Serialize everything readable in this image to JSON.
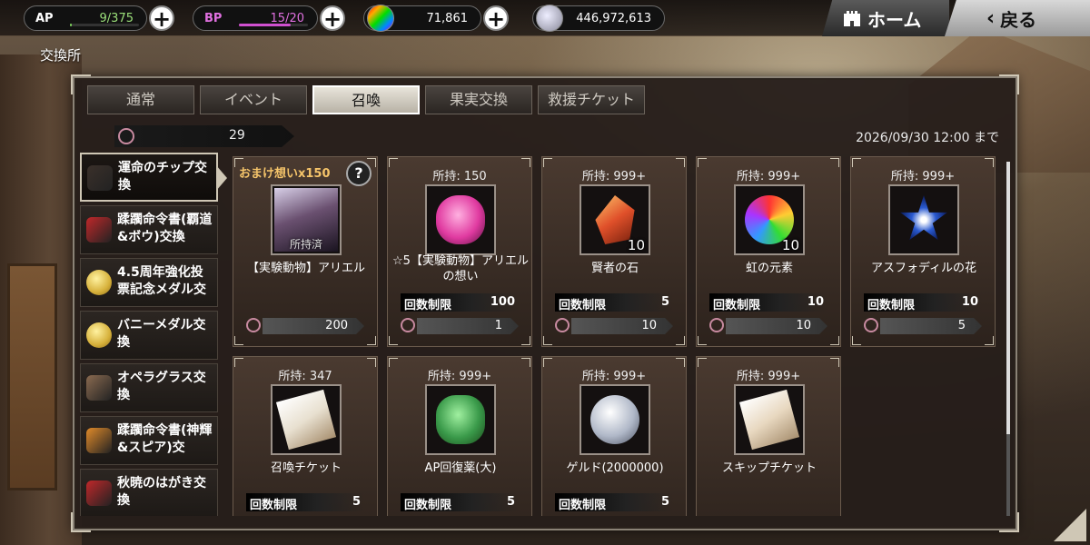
{
  "topbar": {
    "ap": {
      "label": "AP",
      "value": "9/375",
      "fill": 0.024
    },
    "bp": {
      "label": "BP",
      "value": "15/20",
      "fill": 0.75
    },
    "crystals": "71,861",
    "money": "446,972,613",
    "home_label": "ホーム",
    "back_label": "戻る"
  },
  "page_title": "交換所",
  "tabs": [
    "通常",
    "イベント",
    "召喚",
    "果実交換",
    "救援チケット"
  ],
  "active_tab": 2,
  "currency_count": "29",
  "deadline": "2026/09/30 12:00 まで",
  "sidebar": [
    {
      "label": "運命のチップ交換",
      "icon": "chip-icon",
      "color": "#3a302a"
    },
    {
      "label": "蹂躙命令書(覇道&ボウ)交換",
      "icon": "scroll-red-icon",
      "color": "#c0282a"
    },
    {
      "label": "4.5周年強化投票記念メダル交",
      "icon": "medal-icon",
      "color": "#d6b03a"
    },
    {
      "label": "バニーメダル交換",
      "icon": "medal-icon",
      "color": "#d6b03a"
    },
    {
      "label": "オペラグラス交換",
      "icon": "opera-glass-icon",
      "color": "#8a6a50"
    },
    {
      "label": "蹂躙命令書(神輝&スピア)交",
      "icon": "scroll-orange-icon",
      "color": "#e08a2a"
    },
    {
      "label": "秋暁のはがき交換",
      "icon": "postcard-icon",
      "color": "#c0282a"
    }
  ],
  "items": [
    {
      "bonus": "おまけ想いx150",
      "owned": "",
      "qty": "",
      "owned_tag": "所持済",
      "name": "【実験動物】アリエル",
      "limit_label": "",
      "limit": "",
      "cost": "200",
      "icon": "character-portrait-icon",
      "color": "#6a5070"
    },
    {
      "bonus": "",
      "owned": "所持: 150",
      "qty": "",
      "owned_tag": "",
      "name": "☆5【実験動物】アリエルの想い",
      "limit_label": "回数制限",
      "limit": "100",
      "cost": "1",
      "icon": "pink-gem-icon",
      "color": "#e03aa0"
    },
    {
      "bonus": "",
      "owned": "所持: 999+",
      "qty": "10",
      "owned_tag": "",
      "name": "賢者の石",
      "limit_label": "回数制限",
      "limit": "5",
      "cost": "10",
      "icon": "red-crystal-icon",
      "color": "#e0502a"
    },
    {
      "bonus": "",
      "owned": "所持: 999+",
      "qty": "10",
      "owned_tag": "",
      "name": "虹の元素",
      "limit_label": "回数制限",
      "limit": "10",
      "cost": "10",
      "icon": "rainbow-orb-icon",
      "color": "#8a4ad0"
    },
    {
      "bonus": "",
      "owned": "所持: 999+",
      "qty": "",
      "owned_tag": "",
      "name": "アスフォディルの花",
      "limit_label": "回数制限",
      "limit": "10",
      "cost": "5",
      "icon": "blue-flower-icon",
      "color": "#2a5ad0"
    },
    {
      "bonus": "",
      "owned": "所持: 347",
      "qty": "",
      "owned_tag": "",
      "name": "召喚チケット",
      "limit_label": "回数制限",
      "limit": "5",
      "cost": "",
      "icon": "ticket-icon",
      "color": "#e8e0d0"
    },
    {
      "bonus": "",
      "owned": "所持: 999+",
      "qty": "",
      "owned_tag": "",
      "name": "AP回復薬(大)",
      "limit_label": "回数制限",
      "limit": "5",
      "cost": "",
      "icon": "potion-icon",
      "color": "#3a9a4a"
    },
    {
      "bonus": "",
      "owned": "所持: 999+",
      "qty": "",
      "owned_tag": "",
      "name": "ゲルド(2000000)",
      "limit_label": "回数制限",
      "limit": "5",
      "cost": "",
      "icon": "silver-coin-icon",
      "color": "#b0b8c8"
    },
    {
      "bonus": "",
      "owned": "所持: 999+",
      "qty": "",
      "owned_tag": "",
      "name": "スキップチケット",
      "limit_label": "",
      "limit": "",
      "cost": "",
      "icon": "skip-ticket-icon",
      "color": "#e8d8c0"
    }
  ]
}
